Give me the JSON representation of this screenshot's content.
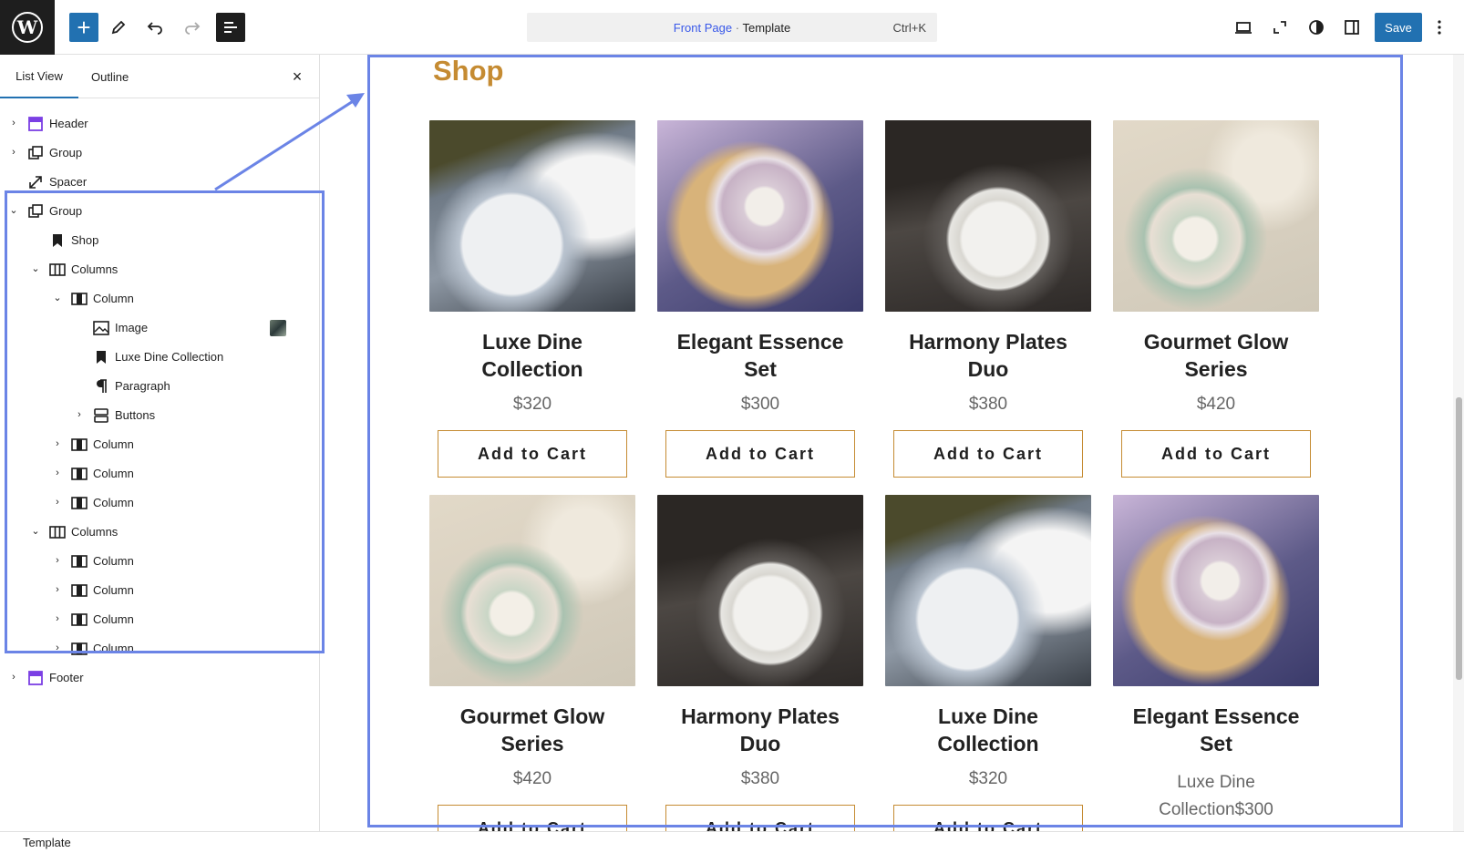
{
  "toolbar": {
    "command_bar_title": "Front Page",
    "command_bar_separator": "·",
    "command_bar_type": "Template",
    "command_bar_shortcut": "Ctrl+K",
    "save_label": "Save",
    "add_glyph": "+"
  },
  "sidebar": {
    "tabs": [
      "List View",
      "Outline"
    ],
    "close_glyph": "×",
    "tree": [
      {
        "label": "Header",
        "icon": "template-part-icon",
        "expander": "›",
        "depth": 0
      },
      {
        "label": "Group",
        "icon": "group-icon",
        "expander": "›",
        "depth": 0
      },
      {
        "label": "Spacer",
        "icon": "spacer-icon",
        "expander": "",
        "depth": 0
      },
      {
        "label": "Group",
        "icon": "group-icon",
        "expander": "⌄",
        "depth": 0
      },
      {
        "label": "Shop",
        "icon": "bookmark-icon",
        "expander": "",
        "depth": 1
      },
      {
        "label": "Columns",
        "icon": "columns-icon",
        "expander": "⌄",
        "depth": 1
      },
      {
        "label": "Column",
        "icon": "column-icon",
        "expander": "⌄",
        "depth": 2
      },
      {
        "label": "Image",
        "icon": "image-icon",
        "expander": "",
        "depth": 3
      },
      {
        "label": "Luxe Dine Collection",
        "icon": "bookmark-icon",
        "expander": "",
        "depth": 3
      },
      {
        "label": "Paragraph",
        "icon": "paragraph-icon",
        "expander": "",
        "depth": 3
      },
      {
        "label": "Buttons",
        "icon": "buttons-icon",
        "expander": "›",
        "depth": 3
      },
      {
        "label": "Column",
        "icon": "column-icon",
        "expander": "›",
        "depth": 2
      },
      {
        "label": "Column",
        "icon": "column-icon",
        "expander": "›",
        "depth": 2
      },
      {
        "label": "Column",
        "icon": "column-icon",
        "expander": "›",
        "depth": 2
      },
      {
        "label": "Columns",
        "icon": "columns-icon",
        "expander": "⌄",
        "depth": 1
      },
      {
        "label": "Column",
        "icon": "column-icon",
        "expander": "›",
        "depth": 2
      },
      {
        "label": "Column",
        "icon": "column-icon",
        "expander": "›",
        "depth": 2
      },
      {
        "label": "Column",
        "icon": "column-icon",
        "expander": "›",
        "depth": 2
      },
      {
        "label": "Column",
        "icon": "column-icon",
        "expander": "›",
        "depth": 2
      },
      {
        "label": "Footer",
        "icon": "template-part-icon",
        "expander": "›",
        "depth": 0
      }
    ]
  },
  "canvas": {
    "heading": "Shop",
    "button_label": "Add to Cart",
    "products_row1": [
      {
        "name": "Luxe Dine Collection",
        "price": "$320",
        "image": "blue-floral-plates"
      },
      {
        "name": "Elegant Essence Set",
        "price": "$300",
        "image": "pumpkin-gold-charger"
      },
      {
        "name": "Harmony Plates Duo",
        "price": "$380",
        "image": "white-plate-wicker"
      },
      {
        "name": "Gourmet Glow Series",
        "price": "$420",
        "image": "pink-floral-plates"
      }
    ],
    "products_row2": [
      {
        "name": "Gourmet Glow Series",
        "price": "$420",
        "image": "pink-floral-plates"
      },
      {
        "name": "Harmony Plates Duo",
        "price": "$380",
        "image": "white-plate-wicker"
      },
      {
        "name": "Luxe Dine Collection",
        "price": "$320",
        "image": "blue-floral-plates"
      },
      {
        "name": "Elegant Essence Set",
        "price": "Luxe Dine Collection$300",
        "image": "pumpkin-gold-charger"
      }
    ]
  },
  "footer": {
    "breadcrumb": "Template"
  },
  "colors": {
    "accent": "#2271b1",
    "highlight_outline": "#6b84e6",
    "shop_gold": "#c58b32"
  }
}
